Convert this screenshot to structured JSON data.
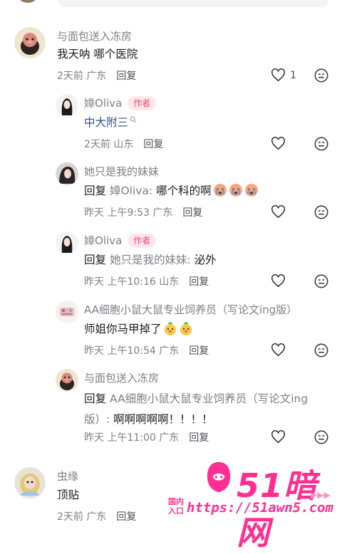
{
  "comments": [
    {
      "name": "与面包送入冻房",
      "author_badge": "",
      "content": "我天呐 哪个医院",
      "time": "2天前",
      "location": "广东",
      "reply_label": "回复",
      "like_count": "1"
    },
    {
      "name": "嫜Oliva",
      "author_badge": "作者",
      "content": "中大附三",
      "time": "2天前",
      "location": "山东",
      "reply_label": "回复",
      "like_count": ""
    },
    {
      "name": "她只是我的妹妹",
      "author_badge": "",
      "reply_prefix": "回复",
      "reply_target": "嫜Oliva:",
      "content": "哪个科的啊",
      "time": "昨天 上午9:53",
      "location": "广东",
      "reply_label": "回复",
      "like_count": ""
    },
    {
      "name": "嫜Oliva",
      "author_badge": "作者",
      "reply_prefix": "回复",
      "reply_target": "她只是我的妹妹:",
      "content": "泌外",
      "time": "昨天 上午10:16",
      "location": "山东",
      "reply_label": "回复",
      "like_count": ""
    },
    {
      "name": "AA细胞小鼠大鼠专业饲养员（写论文ing版）",
      "author_badge": "",
      "content": "师姐你马甲掉了",
      "time": "昨天 上午10:54",
      "location": "广东",
      "reply_label": "回复",
      "like_count": ""
    },
    {
      "name": "与面包送入冻房",
      "author_badge": "",
      "reply_prefix": "回复",
      "reply_target": "AA细胞小鼠大鼠专业饲养员（写论文ing版）:",
      "content": "啊啊啊啊啊！！！！",
      "time": "昨天 上午11:00",
      "location": "广东",
      "reply_label": "回复",
      "like_count": ""
    },
    {
      "name": "虫缘",
      "author_badge": "",
      "content": "顶贴",
      "time": "2天前",
      "location": "广东",
      "reply_label": "回复",
      "like_count": ""
    }
  ],
  "watermark": {
    "logo": "51暗网",
    "entry_label": "国内入口",
    "url": "https://51awn5.com"
  },
  "colors": {
    "author_badge_text": "#ef4a6a",
    "author_badge_bg": "#fde7ec",
    "link_text": "#2c4f86",
    "watermark": "#ff2f92"
  }
}
